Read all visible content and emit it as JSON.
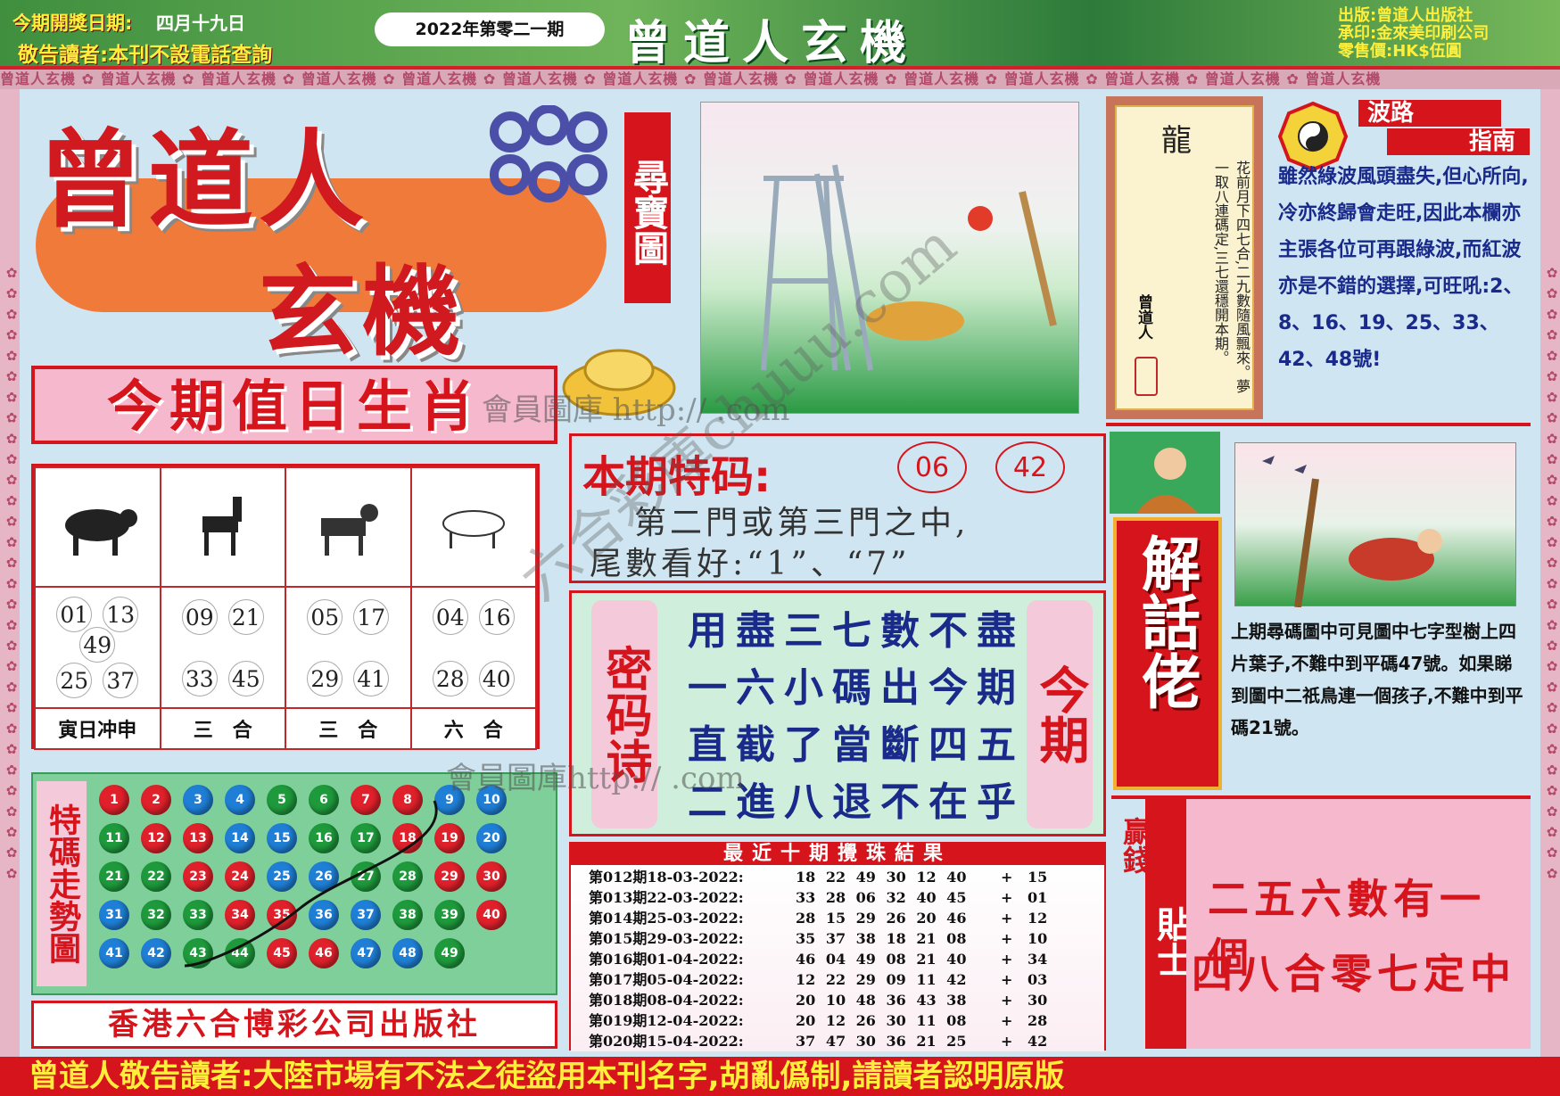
{
  "header": {
    "draw_date_label": "今期開獎日期:",
    "draw_date": "四月十九日",
    "notice": "敬告讀者:本刊不設電話查詢",
    "issue": "2022年第零二一期",
    "title": "曾道人玄機",
    "publisher": "出版:曾道人出版社",
    "printer": "承印:金來美印刷公司",
    "price": "零售價:HK$伍圓"
  },
  "ornament_text": "曾道人玄機",
  "logo": {
    "line1": "曾道人",
    "line2": "玄機",
    "tag": "尋寶圖"
  },
  "zodiac_panel": {
    "title": "今期值日生肖",
    "animals": [
      "tiger-icon",
      "horse-icon",
      "dog-icon",
      "ox-icon"
    ],
    "numbers": [
      [
        "01",
        "13",
        "49",
        "25",
        "37"
      ],
      [
        "09",
        "21",
        "33",
        "45"
      ],
      [
        "05",
        "17",
        "29",
        "41"
      ],
      [
        "04",
        "16",
        "28",
        "40"
      ]
    ],
    "labels": [
      "寅日冲申",
      "三　合",
      "三　合",
      "六　合"
    ]
  },
  "trend": {
    "label": "特碼走勢圖",
    "balls": [
      [
        "1",
        "r"
      ],
      [
        "2",
        "r"
      ],
      [
        "3",
        "b"
      ],
      [
        "4",
        "b"
      ],
      [
        "5",
        "g"
      ],
      [
        "6",
        "g"
      ],
      [
        "7",
        "r"
      ],
      [
        "8",
        "r"
      ],
      [
        "9",
        "b"
      ],
      [
        "10",
        "b"
      ],
      [
        "11",
        "g"
      ],
      [
        "12",
        "r"
      ],
      [
        "13",
        "r"
      ],
      [
        "14",
        "b"
      ],
      [
        "15",
        "b"
      ],
      [
        "16",
        "g"
      ],
      [
        "17",
        "g"
      ],
      [
        "18",
        "r"
      ],
      [
        "19",
        "r"
      ],
      [
        "20",
        "b"
      ],
      [
        "21",
        "g"
      ],
      [
        "22",
        "g"
      ],
      [
        "23",
        "r"
      ],
      [
        "24",
        "r"
      ],
      [
        "25",
        "b"
      ],
      [
        "26",
        "b"
      ],
      [
        "27",
        "g"
      ],
      [
        "28",
        "g"
      ],
      [
        "29",
        "r"
      ],
      [
        "30",
        "r"
      ],
      [
        "31",
        "b"
      ],
      [
        "32",
        "g"
      ],
      [
        "33",
        "g"
      ],
      [
        "34",
        "r"
      ],
      [
        "35",
        "r"
      ],
      [
        "36",
        "b"
      ],
      [
        "37",
        "b"
      ],
      [
        "38",
        "g"
      ],
      [
        "39",
        "g"
      ],
      [
        "40",
        "r"
      ],
      [
        "41",
        "b"
      ],
      [
        "42",
        "b"
      ],
      [
        "43",
        "g"
      ],
      [
        "44",
        "g"
      ],
      [
        "45",
        "r"
      ],
      [
        "46",
        "r"
      ],
      [
        "47",
        "b"
      ],
      [
        "48",
        "b"
      ],
      [
        "49",
        "g"
      ]
    ]
  },
  "footer_publisher": "香港六合博彩公司出版社",
  "special": {
    "label": "本期特码:",
    "nums": [
      "06",
      "42"
    ],
    "line1": "第二門或第三門之中,",
    "line2": "尾數看好:“1”、“7”"
  },
  "poem": {
    "left_label": "密码诗",
    "right_label": "今期",
    "lines": [
      "用盡三七數不盡",
      "一六小碼出今期",
      "直截了當斷四五",
      "二進八退不在乎"
    ]
  },
  "results": {
    "title": "最近十期攪珠結果",
    "rows": [
      [
        "第012期18-03-2022:",
        "18 22 49 30 12 40",
        "15"
      ],
      [
        "第013期22-03-2022:",
        "33 28 06 32 40 45",
        "01"
      ],
      [
        "第014期25-03-2022:",
        "28 15 29 26 20 46",
        "12"
      ],
      [
        "第015期29-03-2022:",
        "35 37 38 18 21 08",
        "10"
      ],
      [
        "第016期01-04-2022:",
        "46 04 49 08 21 40",
        "34"
      ],
      [
        "第017期05-04-2022:",
        "12 22 29 09 11 42",
        "03"
      ],
      [
        "第018期08-04-2022:",
        "20 10 48 36 43 38",
        "30"
      ],
      [
        "第019期12-04-2022:",
        "20 12 26 30 11 08",
        "28"
      ],
      [
        "第020期15-04-2022:",
        "37 47 30 36 21 25",
        "42"
      ]
    ]
  },
  "dragon_scroll": {
    "title": "龍",
    "poem": "花前月下四七合,二九數隨風飄來。夢一取八連碼定,三七還穩開本期。",
    "signature": "曾道人"
  },
  "wave_guide": {
    "title_top": "波路",
    "title_bottom": "指南",
    "text": "雖然綠波風頭盡失,但心所向,冷亦終歸會走旺,因此本欄亦主張各位可再跟綠波,而紅波亦是不錯的選擇,可旺吼:2、8、16、19、25、33、42、48號!"
  },
  "jiehua": {
    "label": "解話佬",
    "text": "上期尋碼圖中可見圖中七字型樹上四片葉子,不難中到平碼47號。如果睇到圖中二祇鳥連一個孩子,不難中到平碼21號。"
  },
  "tip": {
    "label_a": "贏錢",
    "label_b": "貼士",
    "line1": "二五六數有一個",
    "line2": "四八合零七定中"
  },
  "bottom_banner": "曾道人敬告讀者:大陸市場有不法之徒盜用本刊名字,胡亂僞制,請讀者認明原版",
  "watermark": {
    "line1": "會員圖庫 http://         .com",
    "line2": "會員圖庫http://         .com",
    "diagonal": "六合彩庫chuuu.com"
  },
  "colors": {
    "red": "#d5141c",
    "pink": "#f6b8cd",
    "green": "#3f8f3f",
    "blue_bg": "#cfe6f2"
  }
}
